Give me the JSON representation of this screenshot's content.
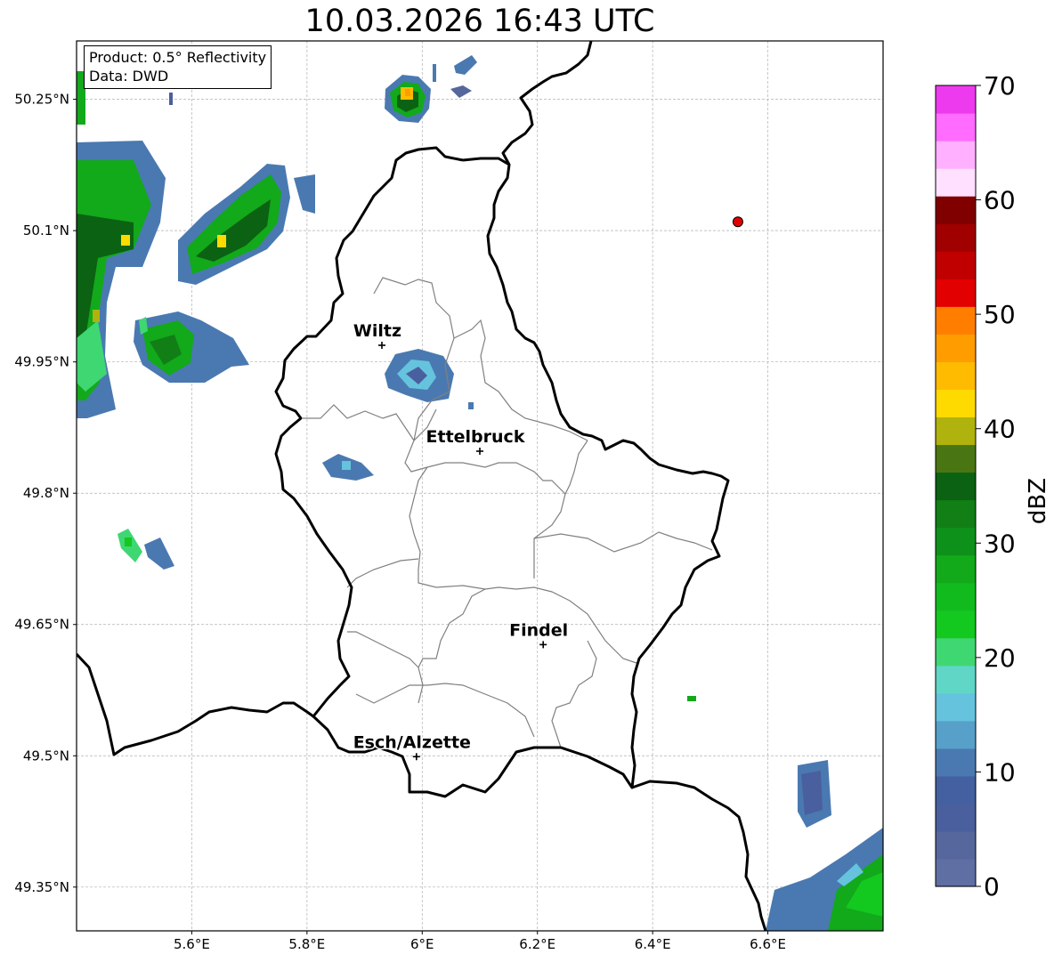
{
  "title": "10.03.2026 16:43 UTC",
  "info": {
    "product": "Product: 0.5° Reflectivity",
    "data": "Data: DWD"
  },
  "colorbar": {
    "label": "dBZ",
    "ticks": [
      0,
      10,
      20,
      30,
      40,
      50,
      60,
      70
    ],
    "colors": [
      "#5f6fa3",
      "#56679d",
      "#4a5f9d",
      "#4460a0",
      "#4a79b1",
      "#57a0c9",
      "#65c3de",
      "#60d6c6",
      "#3fd772",
      "#13c81f",
      "#11bb1e",
      "#12a91b",
      "#0e911b",
      "#117f15",
      "#0b6212",
      "#497612",
      "#b0b20d",
      "#ffda00",
      "#ffbb00",
      "#ff9c00",
      "#ff7e00",
      "#e20000",
      "#c00000",
      "#a00000",
      "#800000",
      "#ffe0ff",
      "#ffb0ff",
      "#ff6cff",
      "#ee3aee"
    ]
  },
  "axes": {
    "x_ticks": [
      {
        "value": 5.6,
        "label": "5.6°E"
      },
      {
        "value": 5.8,
        "label": "5.8°E"
      },
      {
        "value": 6.0,
        "label": "6°E"
      },
      {
        "value": 6.2,
        "label": "6.2°E"
      },
      {
        "value": 6.4,
        "label": "6.4°E"
      },
      {
        "value": 6.6,
        "label": "6.6°E"
      }
    ],
    "y_ticks": [
      {
        "value": 50.25,
        "label": "50.25°N"
      },
      {
        "value": 50.1,
        "label": "50.1°N"
      },
      {
        "value": 49.95,
        "label": "49.95°N"
      },
      {
        "value": 49.8,
        "label": "49.8°N"
      },
      {
        "value": 49.65,
        "label": "49.65°N"
      },
      {
        "value": 49.5,
        "label": "49.5°N"
      },
      {
        "value": 49.35,
        "label": "49.35°N"
      }
    ]
  },
  "cities": [
    {
      "name": "Wiltz",
      "lon": 5.93,
      "lat": 49.969
    },
    {
      "name": "Ettelbruck",
      "lon": 6.1,
      "lat": 49.848
    },
    {
      "name": "Findel",
      "lon": 6.21,
      "lat": 49.627
    },
    {
      "name": "Esch/Alzette",
      "lon": 5.99,
      "lat": 49.499
    }
  ],
  "radar_site": {
    "lon": 6.548,
    "lat": 50.11,
    "color": "#e00000"
  }
}
